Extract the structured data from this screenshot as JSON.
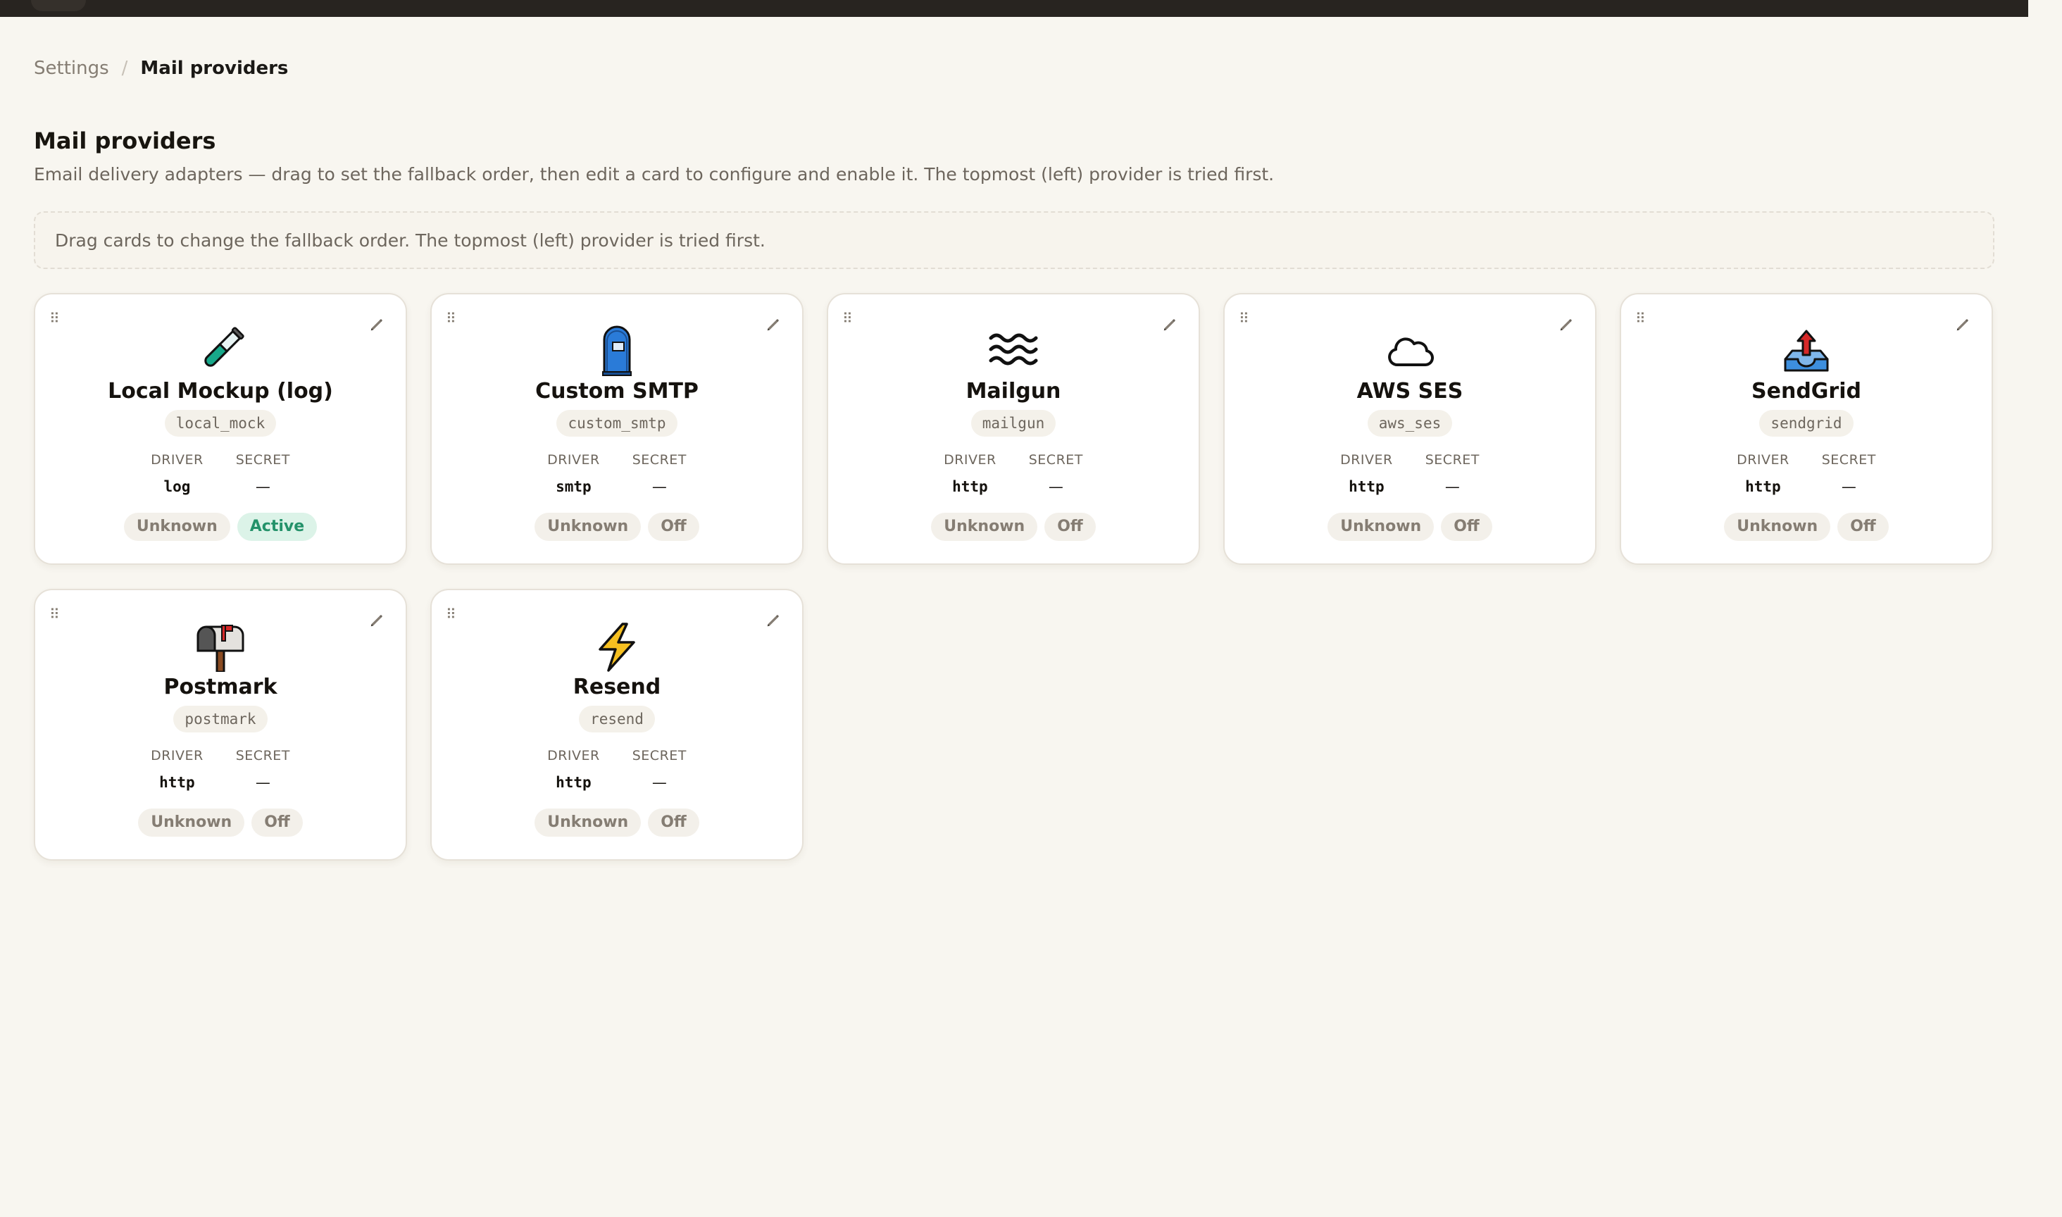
{
  "breadcrumb": {
    "parent": "Settings",
    "separator": "/",
    "current": "Mail providers"
  },
  "page": {
    "title": "Mail providers",
    "description": "Email delivery adapters — drag to set the fallback order, then edit a card to configure and enable it. The topmost (left) provider is tried first."
  },
  "hint": "Drag cards to change the fallback order. The topmost (left) provider is tried first.",
  "labels": {
    "driver": "DRIVER",
    "secret": "SECRET",
    "drag_glyph": "⠿",
    "edit_glyph": "✎"
  },
  "providers": [
    {
      "name": "Local Mockup (log)",
      "slug": "local_mock",
      "driver": "log",
      "secret": "—",
      "health": "Unknown",
      "status": "Active",
      "icon": "test-tube-icon"
    },
    {
      "name": "Custom SMTP",
      "slug": "custom_smtp",
      "driver": "smtp",
      "secret": "—",
      "health": "Unknown",
      "status": "Off",
      "icon": "postbox-icon"
    },
    {
      "name": "Mailgun",
      "slug": "mailgun",
      "driver": "http",
      "secret": "—",
      "health": "Unknown",
      "status": "Off",
      "icon": "waves-icon"
    },
    {
      "name": "AWS SES",
      "slug": "aws_ses",
      "driver": "http",
      "secret": "—",
      "health": "Unknown",
      "status": "Off",
      "icon": "cloud-icon"
    },
    {
      "name": "SendGrid",
      "slug": "sendgrid",
      "driver": "http",
      "secret": "—",
      "health": "Unknown",
      "status": "Off",
      "icon": "outbox-tray-icon"
    },
    {
      "name": "Postmark",
      "slug": "postmark",
      "driver": "http",
      "secret": "—",
      "health": "Unknown",
      "status": "Off",
      "icon": "mailbox-icon"
    },
    {
      "name": "Resend",
      "slug": "resend",
      "driver": "http",
      "secret": "—",
      "health": "Unknown",
      "status": "Off",
      "icon": "lightning-icon"
    }
  ],
  "colors": {
    "active_text": "#24926a",
    "active_bg": "#dcf3e8",
    "background": "#f8f6f0",
    "topbar": "#282420"
  }
}
